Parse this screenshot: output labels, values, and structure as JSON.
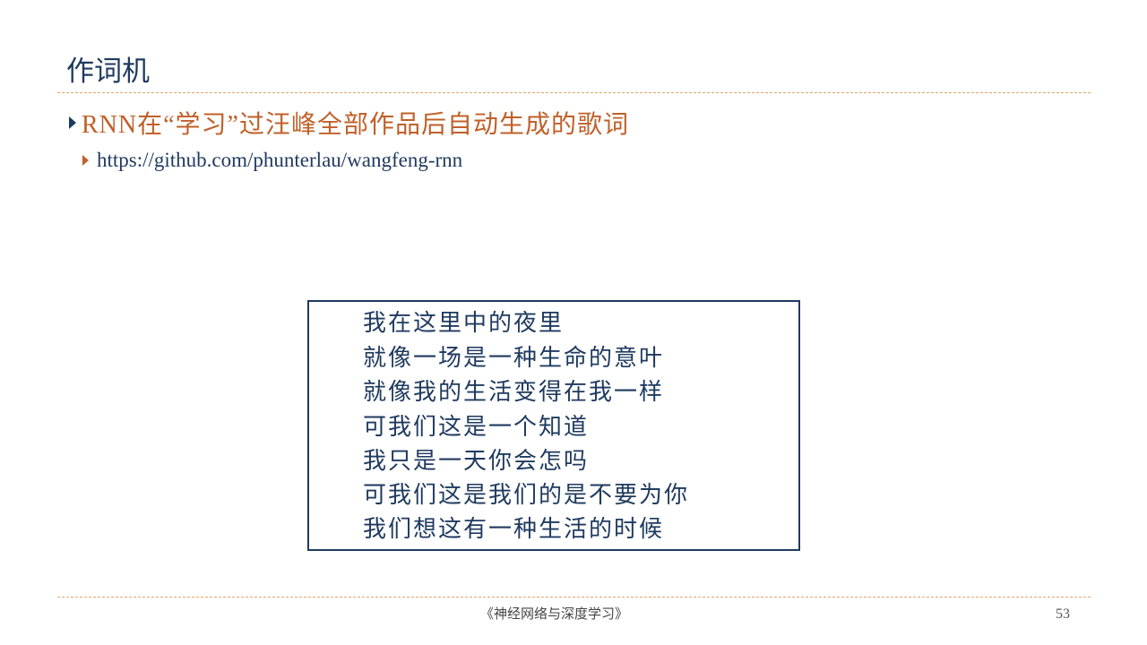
{
  "slide": {
    "title": "作词机",
    "bullet_1": "RNN在“学习”过汪峰全部作品后自动生成的歌词",
    "bullet_2": "https://github.com/phunterlau/wangfeng-rnn",
    "lyrics": [
      "我在这里中的夜里",
      "就像一场是一种生命的意叶",
      "就像我的生活变得在我一样",
      "可我们这是一个知道",
      "我只是一天你会怎吗",
      "可我们这是我们的是不要为你",
      "我们想这有一种生活的时候"
    ]
  },
  "footer": {
    "book_title": "《神经网络与深度学习》",
    "page_number": "53"
  },
  "colors": {
    "title": "#1f3a5f",
    "accent_orange": "#c0602a",
    "rule": "#e4a56a",
    "box_border": "#1f3a5f"
  }
}
